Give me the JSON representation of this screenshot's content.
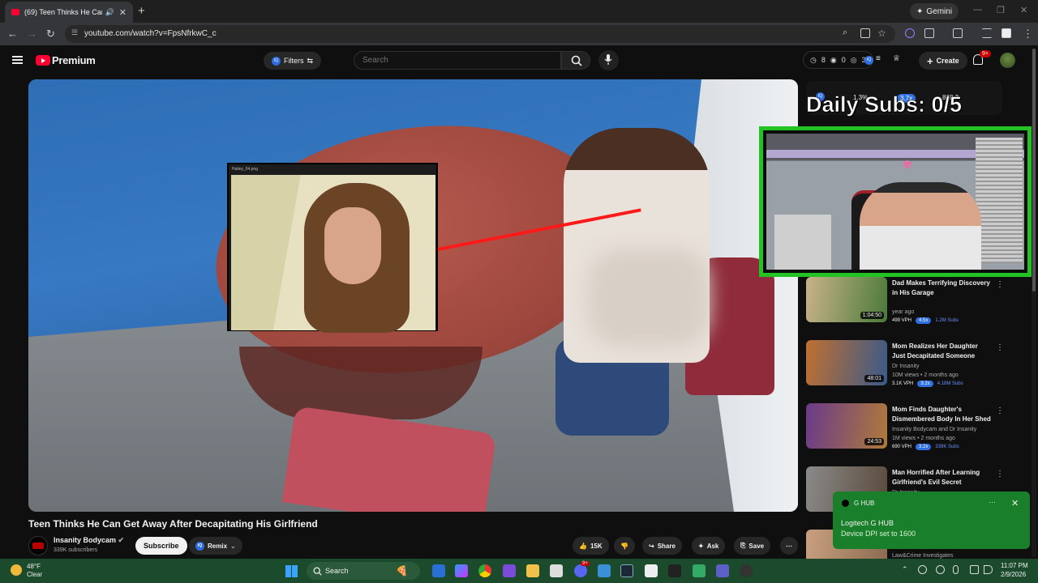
{
  "browser": {
    "tab_title": "(69) Teen Thinks He Can Get",
    "tab_close": "✕",
    "new_tab": "+",
    "gemini_label": "Gemini",
    "url": "youtube.com/watch?v=FpsNfrkwC_c"
  },
  "header": {
    "logo_label": "Premium",
    "filters_label": "Filters",
    "search_placeholder": "Search",
    "stats": {
      "clock": "8",
      "eye": "0",
      "other": "3"
    },
    "create_label": "Create",
    "notif_count": "9+"
  },
  "player": {
    "pip_label": "Hailey_04.png"
  },
  "overlay": {
    "daily_subs": "Daily Subs: 0/5",
    "stat1": "1.3%",
    "stat2": "3.7x",
    "stat3": "868.3"
  },
  "video": {
    "title": "Teen Thinks He Can Get Away After Decapitating His Girlfriend",
    "channel": "Insanity Bodycam",
    "subscribers": "339K subscribers",
    "subscribe_label": "Subscribe",
    "remix_label": "Remix",
    "likes": "15K",
    "share_label": "Share",
    "ask_label": "Ask",
    "save_label": "Save"
  },
  "recommendations": [
    {
      "title": "Dad Makes Terrifying Discovery in His Garage",
      "channel": "",
      "views": "year ago",
      "duration": "1:04:50",
      "vph": "499 VPH",
      "mult": "4.5x",
      "subs": "1.2M Subs",
      "thumb_colors": [
        "#c9b28a",
        "#4a7a3a"
      ]
    },
    {
      "title": "Mom Realizes Her Daughter Just Decapitated Someone",
      "channel": "Dr Insanity",
      "views": "10M views • 2 months ago",
      "duration": "48:01",
      "vph": "3.1K VPH",
      "mult": "3.2x",
      "subs": "4.18M Subs",
      "thumb_colors": [
        "#c07030",
        "#3a5a8a"
      ]
    },
    {
      "title": "Mom Finds Daughter's Dismembered Body In Her Shed",
      "channel": "Insanity Bodycam and Dr Insanity",
      "views": "1M views • 2 months ago",
      "duration": "24:53",
      "vph": "690 VPH",
      "mult": "3.2x",
      "subs": "339K Subs",
      "thumb_colors": [
        "#6a3a8a",
        "#b07a3a"
      ]
    },
    {
      "title": "Man Horrified After Learning Girlfriend's Evil Secret",
      "channel": "Dr Insanity",
      "views": "",
      "duration": "",
      "vph": "",
      "mult": "",
      "subs": "",
      "thumb_colors": [
        "#8a8a8a",
        "#5a4a3a"
      ]
    },
    {
      "title": "",
      "channel": "Law&Crime Investigates",
      "views": "",
      "duration": "",
      "vph": "",
      "mult": "",
      "subs": "",
      "thumb_colors": [
        "#c9a080",
        "#8a6a50"
      ]
    }
  ],
  "toast": {
    "app": "G HUB",
    "title": "Logitech G HUB",
    "body": "Device DPI set to 1600",
    "more": "···",
    "close": "✕"
  },
  "taskbar": {
    "temp": "48°F",
    "condition": "Clear",
    "search_label": "Search",
    "time": "11:07 PM",
    "date": "2/9/2026",
    "badge": "9+"
  },
  "colors": {
    "youtube_red": "#ff0033",
    "webcam_border": "#22c322",
    "toast_bg": "#1a7f2a",
    "taskbar_bg": "#1b4a2c",
    "chip_blue": "#2f6fe0"
  }
}
